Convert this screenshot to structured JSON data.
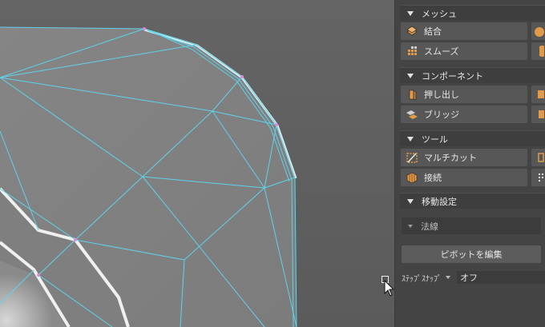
{
  "panel": {
    "sections": [
      {
        "title": "メッシュ",
        "tools": [
          {
            "label": "結合",
            "icon": "combine-icon"
          },
          {
            "label": "スムーズ",
            "icon": "smooth-icon"
          }
        ]
      },
      {
        "title": "コンポーネント",
        "tools": [
          {
            "label": "押し出し",
            "icon": "extrude-icon"
          },
          {
            "label": "ブリッジ",
            "icon": "bridge-icon"
          }
        ]
      },
      {
        "title": "ツール",
        "tools": [
          {
            "label": "マルチカット",
            "icon": "multicut-icon"
          },
          {
            "label": "接続",
            "icon": "connect-icon"
          }
        ]
      },
      {
        "title": "移動設定"
      }
    ],
    "move_settings": {
      "axis_value": "法線",
      "edit_pivot_label": "ピボットを編集",
      "step_snap_label": "ｽﾃｯﾌﾟｽﾅｯﾌﾟ",
      "step_snap_value": "オフ"
    }
  },
  "colors": {
    "wireframe": "#5fd3ea",
    "panel_bg": "#444444",
    "viewport_bg": "#5f5f5f",
    "icon_orange": "#e39a48"
  }
}
